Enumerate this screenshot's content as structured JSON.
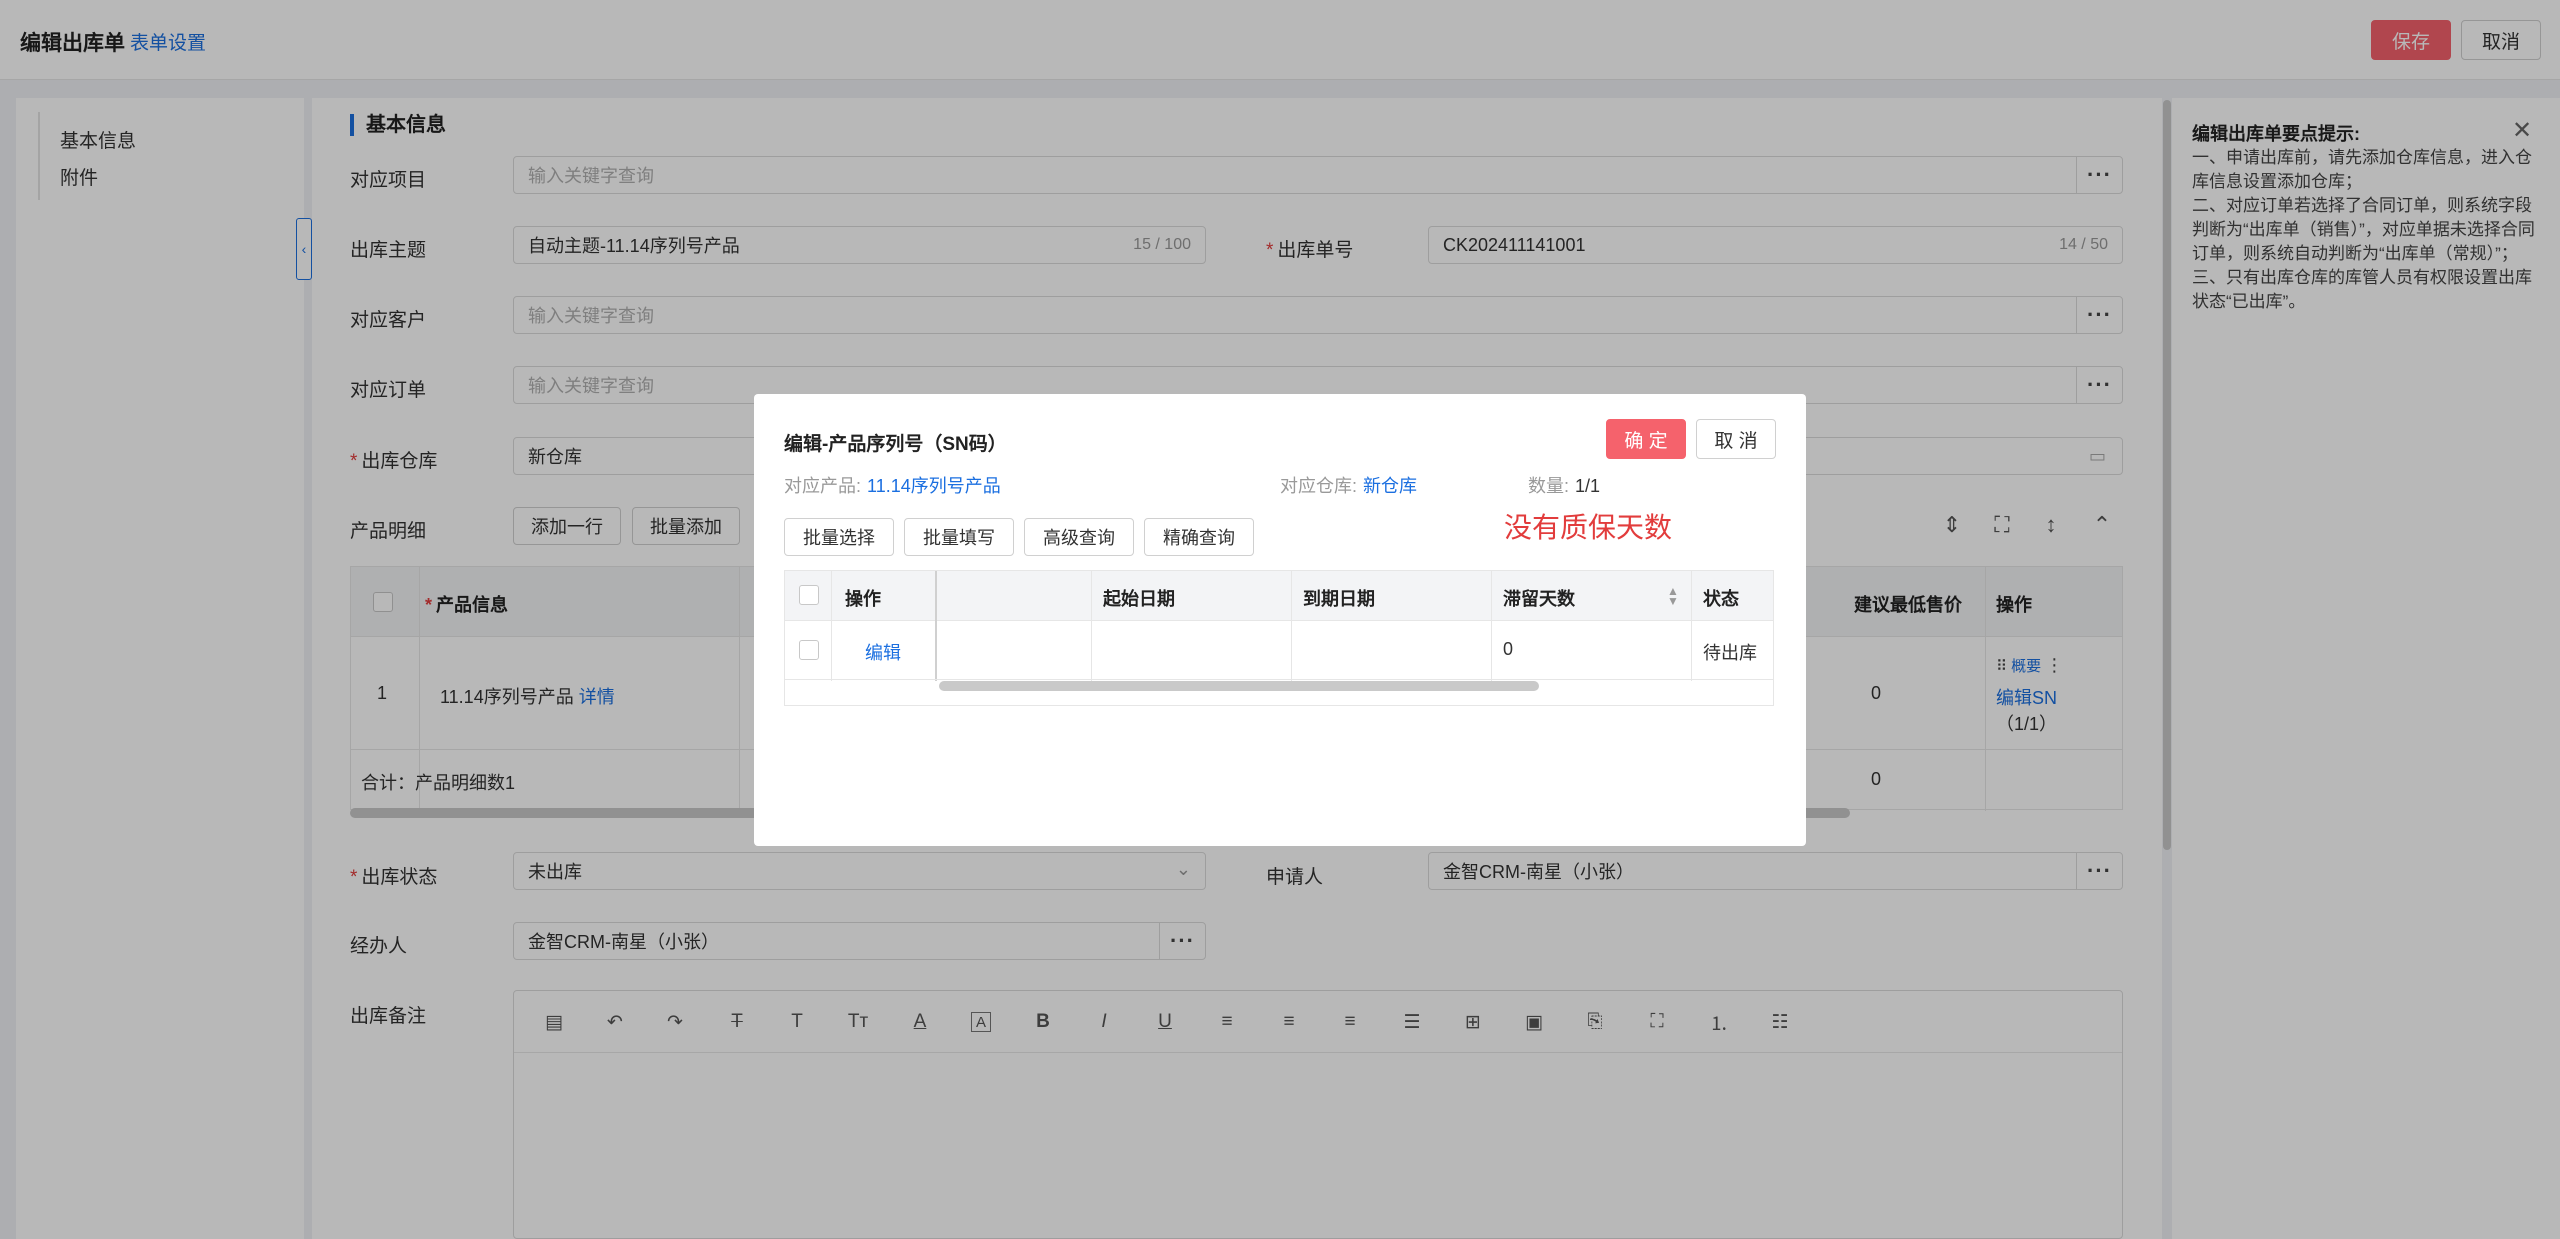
{
  "header": {
    "title": "编辑出库单",
    "form_settings": "表单设置",
    "save": "保存",
    "cancel": "取消"
  },
  "left_nav": {
    "items": [
      "基本信息",
      "附件"
    ]
  },
  "section": {
    "title": "基本信息"
  },
  "form": {
    "project": {
      "label": "对应项目",
      "placeholder": "输入关键字查询"
    },
    "subject": {
      "label": "出库主题",
      "value": "自动主题-11.14序列号产品",
      "counter": "15 / 100"
    },
    "number": {
      "label": "出库单号",
      "value": "CK202411141001",
      "counter": "14 / 50"
    },
    "customer": {
      "label": "对应客户",
      "placeholder": "输入关键字查询"
    },
    "order": {
      "label": "对应订单",
      "placeholder": "输入关键字查询"
    },
    "warehouse": {
      "label": "出库仓库",
      "value": "新仓库"
    },
    "details": {
      "label": "产品明细",
      "add_row": "添加一行",
      "batch_add": "批量添加"
    },
    "status": {
      "label": "出库状态",
      "value": "未出库"
    },
    "applicant": {
      "label": "申请人",
      "value": "金智CRM-南星（小张）"
    },
    "handler": {
      "label": "经办人",
      "value": "金智CRM-南星（小张）"
    },
    "remark": {
      "label": "出库备注"
    }
  },
  "product_table": {
    "headers": {
      "product": "产品信息",
      "min_price": "建议最低售价",
      "ops": "操作"
    },
    "row": {
      "index": "1",
      "product": "11.14序列号产品",
      "detail": "详情",
      "min_price": "0",
      "summary": "概要",
      "edit_sn": "编辑SN",
      "edit_sn_count": "（1/1）"
    },
    "total": {
      "label": "合计：产品明细数1",
      "min_price": "0"
    }
  },
  "tips": {
    "title": "编辑出库单要点提示:",
    "lines": [
      "一、申请出库前，请先添加仓库信息，进入仓库信息设置添加仓库；",
      "二、对应订单若选择了合同订单，则系统字段判断为“出库单（销售）”，对应单据未选择合同订单，则系统自动判断为“出库单（常规）”；",
      "三、只有出库仓库的库管人员有权限设置出库状态“已出库”。"
    ]
  },
  "modal": {
    "title": "编辑-产品序列号（SN码）",
    "confirm": "确 定",
    "cancel": "取 消",
    "product_label": "对应产品:",
    "product_value": "11.14序列号产品",
    "warehouse_label": "对应仓库:",
    "warehouse_value": "新仓库",
    "qty_label": "数量:",
    "qty_value": "1/1",
    "note": "没有质保天数",
    "buttons": [
      "批量选择",
      "批量填写",
      "高级查询",
      "精确查询"
    ],
    "table": {
      "headers": {
        "ops": "操作",
        "start": "起始日期",
        "end": "到期日期",
        "days": "滞留天数",
        "status": "状态"
      },
      "row": {
        "edit": "编辑",
        "start": "",
        "end": "",
        "days": "0",
        "status": "待出库"
      }
    }
  },
  "colors": {
    "accent": "#1b6fe0",
    "danger": "#f5626c",
    "required": "#e23c3c"
  }
}
